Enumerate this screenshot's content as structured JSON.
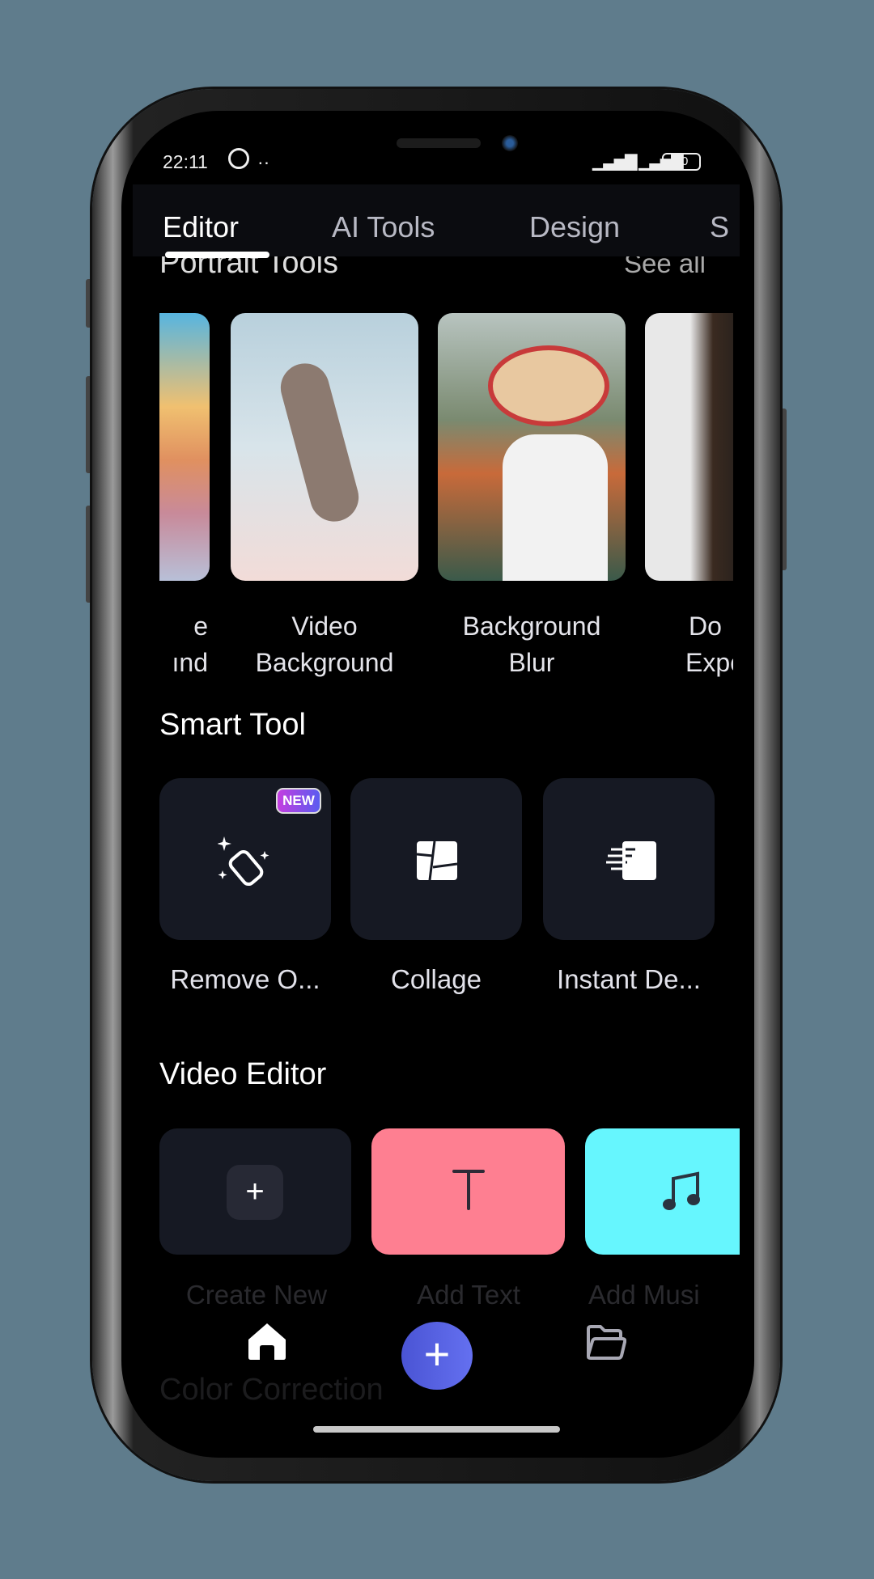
{
  "status_bar": {
    "time": "22:11",
    "battery": "40",
    "whatsapp_icon": "whatsapp-icon",
    "dots": "··"
  },
  "tabs": [
    {
      "label": "Editor",
      "active": true
    },
    {
      "label": "AI Tools"
    },
    {
      "label": "Design"
    },
    {
      "label": "S"
    }
  ],
  "portrait_tools": {
    "title": "Portrait Tools",
    "see_all": "See all",
    "items": [
      {
        "line1": "e",
        "line2": "ınd"
      },
      {
        "line1": "Video",
        "line2": "Background"
      },
      {
        "line1": "Background",
        "line2": "Blur"
      },
      {
        "line1": "Do",
        "line2": "Expo"
      }
    ]
  },
  "smart_tool": {
    "title": "Smart Tool",
    "items": [
      {
        "label": "Remove O...",
        "icon": "eraser-sparkle-icon",
        "badge": "NEW"
      },
      {
        "label": "Collage",
        "icon": "collage-icon"
      },
      {
        "label": "Instant De...",
        "icon": "instant-design-icon"
      }
    ]
  },
  "video_editor": {
    "title": "Video Editor",
    "items": [
      {
        "label": "Create New",
        "icon": "plus-icon",
        "color": "#161923"
      },
      {
        "label": "Add Text",
        "icon": "text-icon",
        "color": "#fe7f91"
      },
      {
        "label": "Add Musi",
        "icon": "music-note-icon",
        "color": "#66f6fe"
      }
    ]
  },
  "color_correction": {
    "title": "Color Correction"
  },
  "bottom_nav": {
    "home": "home-icon",
    "add": "plus-icon",
    "projects": "folder-icon",
    "accent": "#5660e0"
  }
}
